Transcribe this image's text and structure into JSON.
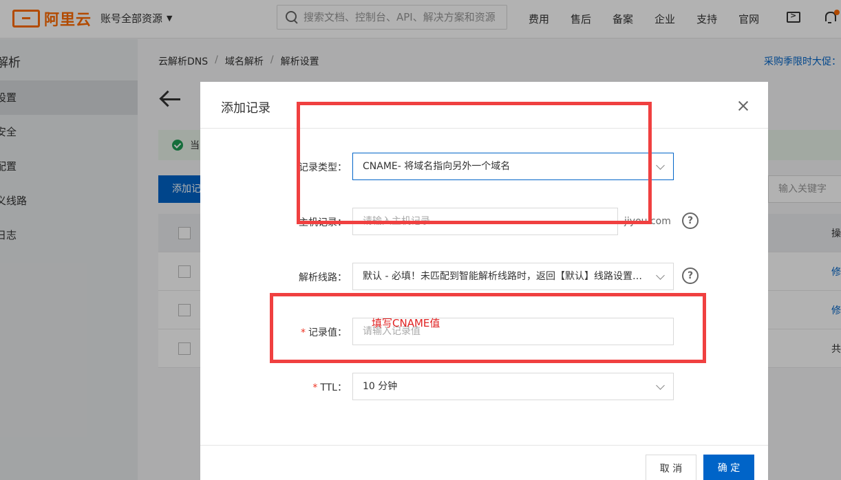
{
  "header": {
    "logo_text": "阿里云",
    "account_label": "账号全部资源",
    "search_placeholder": "搜索文档、控制台、API、解决方案和资源",
    "nav": [
      "费用",
      "售后",
      "备案",
      "企业",
      "支持",
      "官网"
    ]
  },
  "sidebar": {
    "title": "解析",
    "items": [
      "设置",
      "安全",
      "配置",
      "义线路",
      "日志"
    ]
  },
  "main": {
    "breadcrumb": [
      "云解析DNS",
      "域名解析",
      "解析设置"
    ],
    "promo": "采购季限时大促：",
    "notice_text": "当",
    "add_button": "添加记录",
    "keyword_placeholder": "输入关键字",
    "table_right_cells": [
      "操",
      "修",
      "修",
      "共"
    ]
  },
  "modal": {
    "title": "添加记录",
    "fields": {
      "record_type": {
        "label": "记录类型：",
        "value": "CNAME- 将域名指向另外一个域名"
      },
      "host": {
        "label": "主机记录：",
        "placeholder": "请输入主机记录",
        "suffix": "jiyou.com"
      },
      "line": {
        "label": "解析线路：",
        "value": "默认 - 必填！未匹配到智能解析线路时，返回【默认】线路设置结果"
      },
      "value": {
        "label": "记录值：",
        "placeholder": "请输入记录值"
      },
      "ttl": {
        "label": "TTL：",
        "value": "10 分钟"
      }
    },
    "required_mark": "*",
    "help_glyph": "?",
    "cancel_button": "取 消",
    "ok_button": "确 定"
  },
  "annotation": {
    "text": "填写CNAME值",
    "color": "#f04040"
  },
  "colors": {
    "brand": "#ff6a00",
    "primary": "#0064c8",
    "success": "#1f9d55"
  }
}
